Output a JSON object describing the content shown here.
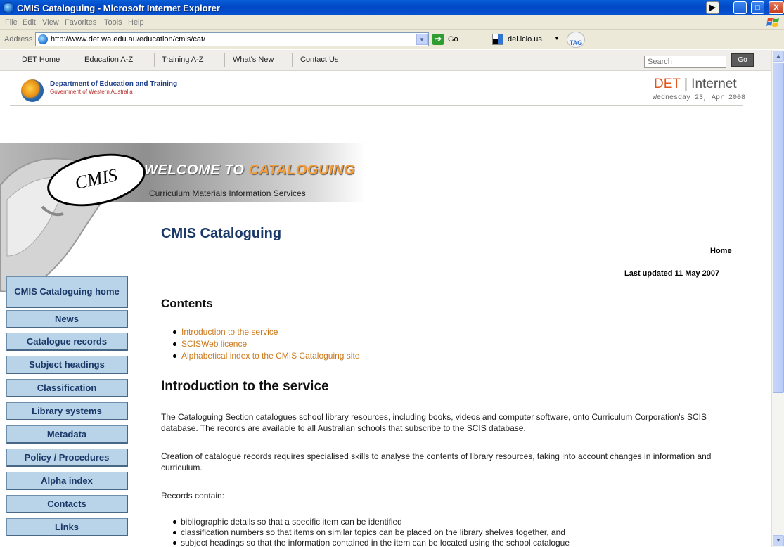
{
  "window": {
    "title": "CMIS Cataloguing - Microsoft Internet Explorer",
    "controls": {
      "minimize": "_",
      "maximize": "□",
      "close": "X"
    }
  },
  "menubar": {
    "items": [
      "File",
      "Edit",
      "View",
      "Favorites",
      "Tools",
      "Help"
    ]
  },
  "addressbar": {
    "label": "Address",
    "url": "http://www.det.wa.edu.au/education/cmis/cat/",
    "go_label": "Go",
    "delicious_label": "del.icio.us",
    "tag_label": "TAG"
  },
  "topnav": {
    "items": [
      "DET Home",
      "Education A-Z",
      "Training A-Z",
      "What's New",
      "Contact Us"
    ],
    "search_placeholder": "Search",
    "search_button": "Go"
  },
  "header": {
    "dept_name": "Department of Education and Training",
    "dept_sub": "Government of Western Australia",
    "brand_det": "DET",
    "brand_sep": " | ",
    "brand_internet": "Internet",
    "date": "Wednesday 23, Apr 2008"
  },
  "banner": {
    "logo_text": "CMIS",
    "welcome_prefix": "WELCOME TO ",
    "welcome_accent": "CATALOGUING",
    "subtitle": "Curriculum Materials Information Services"
  },
  "page": {
    "title": "CMIS Cataloguing",
    "breadcrumb_home": "Home",
    "last_updated": "Last updated 11 May 2007"
  },
  "sidebar": {
    "items": [
      "CMIS Cataloguing home",
      "News",
      "Catalogue records",
      "Subject headings",
      "Classification",
      "Library systems",
      "Metadata",
      "Policy / Procedures",
      "Alpha index",
      "Contacts",
      "Links"
    ]
  },
  "contents": {
    "heading": "Contents",
    "links": [
      "Introduction to the service",
      "SCISWeb licence",
      "Alphabetical index to the CMIS Cataloguing site"
    ]
  },
  "intro": {
    "heading": "Introduction to the service",
    "p1": "The Cataloguing Section catalogues school library resources, including books, videos and computer software, onto Curriculum Corporation's SCIS database. The records are available to all Australian schools that subscribe to the SCIS database.",
    "p2": "Creation of catalogue records requires specialised skills to analyse the contents of library resources, taking into account changes in information and curriculum.",
    "p3": "Records contain:",
    "records_contain": [
      "bibliographic details so that a specific item can be identified",
      "classification numbers so that items on similar topics can be placed on the library shelves together, and",
      "subject headings so that the information contained in the item can be located using the school catalogue"
    ]
  },
  "colors": {
    "titlebar": "#0a5ed8",
    "link_orange": "#cc7a1e",
    "sidebar_button": "#b9d3e8",
    "sidebar_text": "#1a3868",
    "det_orange": "#e0561f"
  }
}
